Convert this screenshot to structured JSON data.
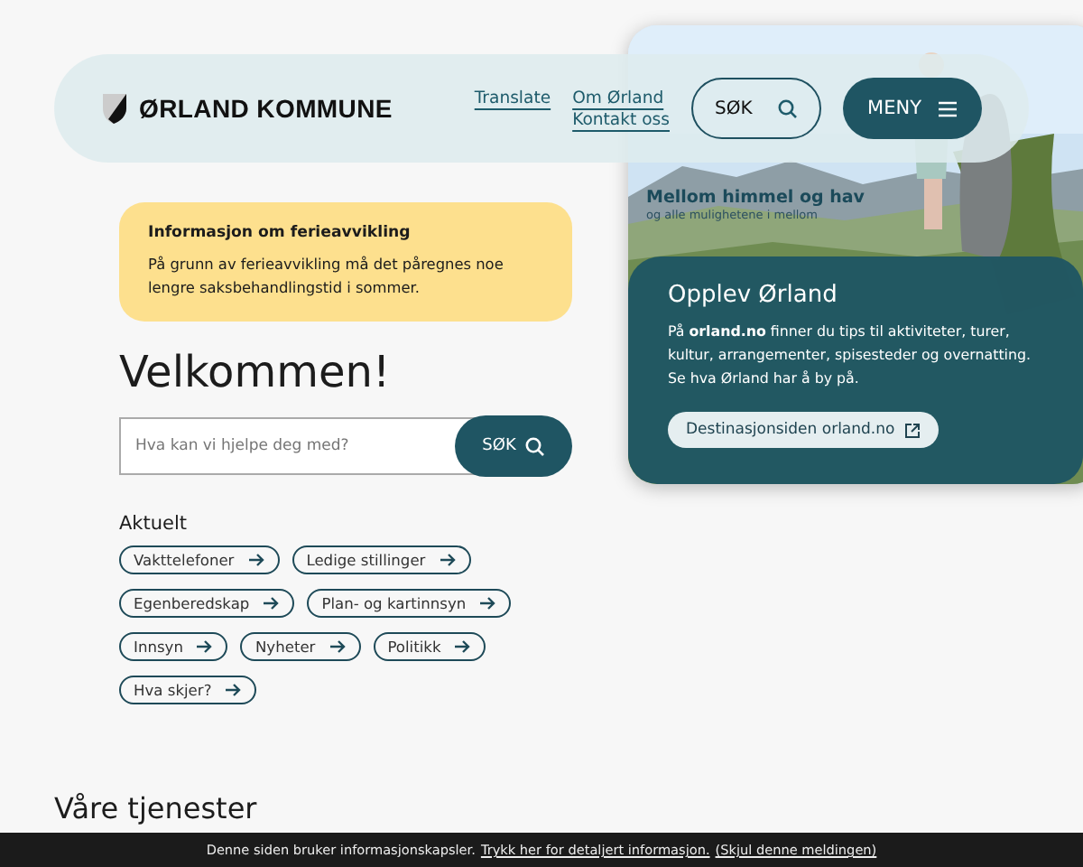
{
  "header": {
    "logo_text": "ØRLAND KOMMUNE",
    "links": [
      {
        "label": "Translate"
      },
      {
        "label": "Om Ørland"
      },
      {
        "label": "Kontakt oss"
      }
    ],
    "search_button": "SØK",
    "menu_button": "MENY"
  },
  "hero": {
    "heading": "Mellom himmel og hav",
    "subheading": "og alle mulighetene i mellom",
    "panel_title": "Opplev Ørland",
    "panel_text": "På **orland.no** finner du tips til aktiviteter, turer, kultur, arrangementer, spisesteder og overnatting. Se hva Ørland har å by på.",
    "panel_button": "Destinasjonsiden orland.no"
  },
  "notice": {
    "title": "Informasjon om ferieavvikling",
    "text": "På grunn av ferieavvikling må det påregnes noe lengre saksbehandlingstid i sommer."
  },
  "welcome": "Velkommen!",
  "search": {
    "placeholder": "Hva kan vi hjelpe deg med?",
    "button": "SØK"
  },
  "aktuelt": {
    "heading": "Aktuelt",
    "links": [
      {
        "label": "Vakttelefoner"
      },
      {
        "label": "Ledige stillinger"
      },
      {
        "label": "Egenberedskap"
      },
      {
        "label": "Plan- og kartinnsyn"
      },
      {
        "label": "Innsyn"
      },
      {
        "label": "Nyheter"
      },
      {
        "label": "Politikk"
      },
      {
        "label": "Hva skjer?"
      }
    ]
  },
  "services_heading": "Våre tjenester",
  "cookie_bar": {
    "text": "Denne siden bruker informasjonskapsler.",
    "link": "Trykk her for detaljert informasjon.",
    "dismiss": "(Skjul denne meldingen)"
  }
}
